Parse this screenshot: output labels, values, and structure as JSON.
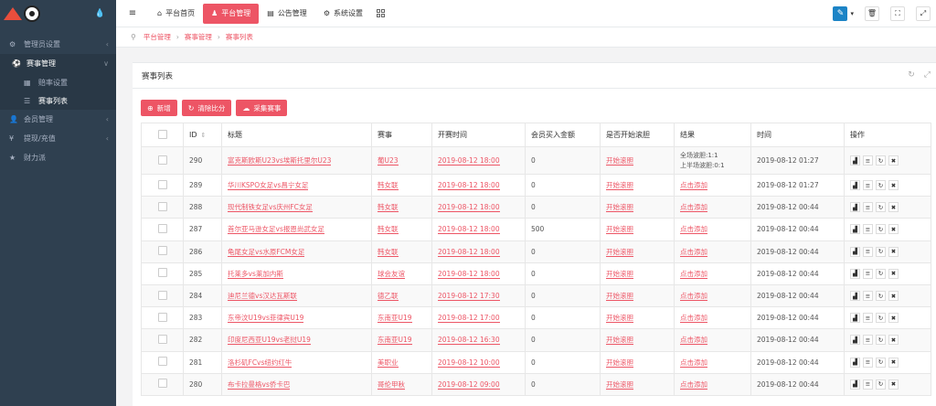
{
  "sidebar": {
    "items": [
      {
        "icon": "⚙",
        "label": "管理员设置",
        "arrow": "‹"
      },
      {
        "icon": "⚽",
        "label": "赛事管理",
        "arrow": "∨",
        "active": true
      },
      {
        "icon": "👤",
        "label": "会员管理",
        "arrow": "‹"
      },
      {
        "icon": "¥",
        "label": "提现/充值",
        "arrow": "‹"
      },
      {
        "icon": "★",
        "label": "财力派",
        "arrow": "‹"
      }
    ],
    "sub_items": [
      {
        "icon": "▦",
        "label": "赔率设置"
      },
      {
        "icon": "☰",
        "label": "赛事列表"
      }
    ]
  },
  "topnav": {
    "items": [
      {
        "icon": "⌂",
        "label": "平台首页"
      },
      {
        "icon": "♟",
        "label": "平台管理"
      },
      {
        "icon": "▤",
        "label": "公告管理"
      },
      {
        "icon": "⚙",
        "label": "系统设置"
      }
    ]
  },
  "breadcrumb": [
    "平台管理",
    "赛事管理",
    "赛事列表"
  ],
  "panel": {
    "title": "赛事列表",
    "buttons": [
      {
        "icon": "⊕",
        "label": "新增"
      },
      {
        "icon": "↻",
        "label": "清除比分"
      },
      {
        "icon": "☁",
        "label": "采集赛事"
      }
    ]
  },
  "table": {
    "headers": [
      "ID",
      "标题",
      "赛事",
      "开赛时间",
      "会员买入金额",
      "是否开始滚胆",
      "结果",
      "时间",
      "操作"
    ],
    "rows": [
      {
        "id": "290",
        "title": "富克斯欧斯U23vs埃斯托里尔U23",
        "league": "葡U23",
        "start": "2019-08-12 18:00",
        "amount": "0",
        "status": "开始滚胆",
        "result1": "全场波胆:1:1",
        "result2": "上半场波胆:0:1",
        "time": "2019-08-12 01:27"
      },
      {
        "id": "289",
        "title": "华川KSPO女足vs昌宁女足",
        "league": "韩女联",
        "start": "2019-08-12 18:00",
        "amount": "0",
        "status": "开始滚胆",
        "result1": "点击添加",
        "result2": "",
        "time": "2019-08-12 01:27"
      },
      {
        "id": "288",
        "title": "现代制铁女足vs庆州FC女足",
        "league": "韩女联",
        "start": "2019-08-12 18:00",
        "amount": "0",
        "status": "开始滚胆",
        "result1": "点击添加",
        "result2": "",
        "time": "2019-08-12 00:44"
      },
      {
        "id": "287",
        "title": "首尔亚马逊女足vs报恩尚武女足",
        "league": "韩女联",
        "start": "2019-08-12 18:00",
        "amount": "500",
        "status": "开始滚胆",
        "result1": "点击添加",
        "result2": "",
        "time": "2019-08-12 00:44"
      },
      {
        "id": "286",
        "title": "龟尾女足vs水原FCM女足",
        "league": "韩女联",
        "start": "2019-08-12 18:00",
        "amount": "0",
        "status": "开始滚胆",
        "result1": "点击添加",
        "result2": "",
        "time": "2019-08-12 00:44"
      },
      {
        "id": "285",
        "title": "托莱多vs莱加内斯",
        "league": "球会友谊",
        "start": "2019-08-12 18:00",
        "amount": "0",
        "status": "开始滚胆",
        "result1": "点击添加",
        "result2": "",
        "time": "2019-08-12 00:44"
      },
      {
        "id": "284",
        "title": "迪尼兰德vs汉达瓦斯联",
        "league": "德乙联",
        "start": "2019-08-12 17:30",
        "amount": "0",
        "status": "开始滚胆",
        "result1": "点击添加",
        "result2": "",
        "time": "2019-08-12 00:44"
      },
      {
        "id": "283",
        "title": "东帝汶U19vs菲律宾U19",
        "league": "东南亚U19",
        "start": "2019-08-12 17:00",
        "amount": "0",
        "status": "开始滚胆",
        "result1": "点击添加",
        "result2": "",
        "time": "2019-08-12 00:44"
      },
      {
        "id": "282",
        "title": "印度尼西亚U19vs老挝U19",
        "league": "东南亚U19",
        "start": "2019-08-12 16:30",
        "amount": "0",
        "status": "开始滚胆",
        "result1": "点击添加",
        "result2": "",
        "time": "2019-08-12 00:44"
      },
      {
        "id": "281",
        "title": "洛杉矶FCvs纽约红牛",
        "league": "美职业",
        "start": "2019-08-12 10:00",
        "amount": "0",
        "status": "开始滚胆",
        "result1": "点击添加",
        "result2": "",
        "time": "2019-08-12 00:44"
      },
      {
        "id": "280",
        "title": "布卡拉曼格vs侨卡巴",
        "league": "哥伦甲秋",
        "start": "2019-08-12 09:00",
        "amount": "0",
        "status": "开始滚胆",
        "result1": "点击添加",
        "result2": "",
        "time": "2019-08-12 00:44"
      }
    ]
  },
  "icons": {
    "drop": "💧",
    "hamburger": "≡",
    "pin": "⚲",
    "refresh": "↻",
    "expand": "⤢",
    "sort": "⇕",
    "op_chart": "▟",
    "op_list": "≡",
    "op_reload": "↻",
    "op_close": "✖",
    "skin": "✎",
    "caret": "▾",
    "trash": "🗑",
    "fullscreen": "⛶",
    "expand_all": "⤢"
  },
  "colors": {
    "accent": "#ed5565",
    "sidebar": "#2f4050",
    "skin": "#1c84c6"
  }
}
